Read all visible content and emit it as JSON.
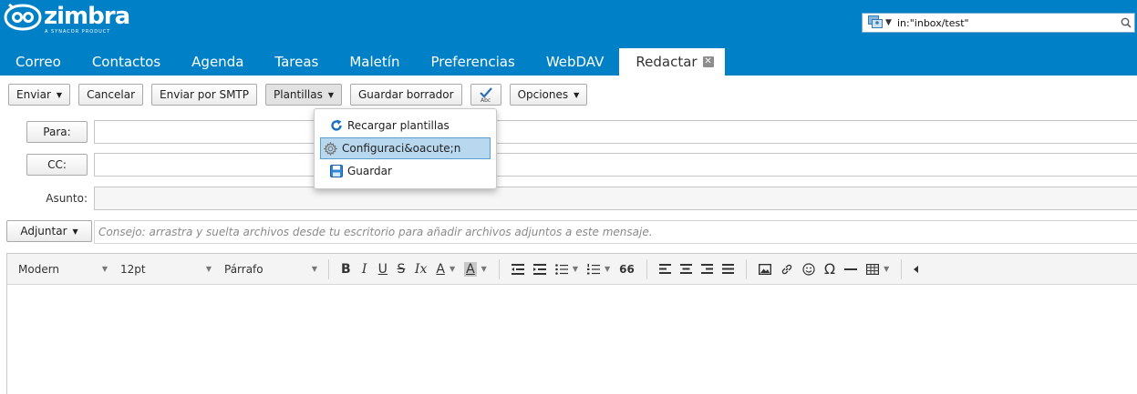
{
  "app": {
    "logo_text": "zimbra",
    "logo_subtext": "A SYNACOR PRODUCT"
  },
  "search": {
    "value": "in:\"inbox/test\""
  },
  "tabs": [
    {
      "label": "Correo"
    },
    {
      "label": "Contactos"
    },
    {
      "label": "Agenda"
    },
    {
      "label": "Tareas"
    },
    {
      "label": "Maletín"
    },
    {
      "label": "Preferencias"
    },
    {
      "label": "WebDAV"
    },
    {
      "label": "Redactar",
      "active": true
    }
  ],
  "toolbar": {
    "send_label": "Enviar",
    "cancel_label": "Cancelar",
    "smtp_label": "Enviar por SMTP",
    "templates_label": "Plantillas",
    "draft_label": "Guardar borrador",
    "spell_icon": "spellcheck-icon",
    "options_label": "Opciones"
  },
  "templates_menu": {
    "items": [
      {
        "label": "Recargar plantillas",
        "icon": "reload-icon"
      },
      {
        "label": "Configuraci&oacute;n",
        "icon": "gear-icon",
        "selected": true
      },
      {
        "label": "Guardar",
        "icon": "save-icon"
      }
    ]
  },
  "compose": {
    "to_label": "Para:",
    "cc_label": "CC:",
    "subject_label": "Asunto:",
    "attach_label": "Adjuntar",
    "attach_hint": "Consejo: arrastra y suelta archivos desde tu escritorio para añadir archivos adjuntos a este mensaje."
  },
  "editor": {
    "font_family": "Modern",
    "font_size": "12pt",
    "block_format": "Párrafo",
    "bold": "B",
    "italic": "I",
    "underline": "U",
    "strike": "S",
    "clear_format": "Ix",
    "font_color": "A",
    "highlight": "A",
    "blockquote": "66",
    "special_char": "Ω"
  },
  "colors": {
    "brand": "#0080c6",
    "menu_selected": "#b8d8ef"
  }
}
